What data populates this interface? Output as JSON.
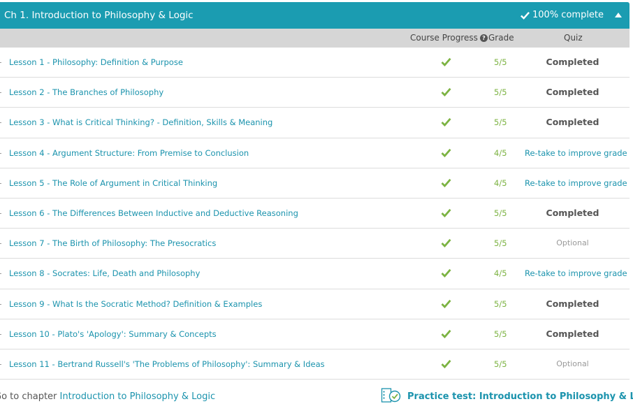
{
  "chapter": {
    "title": "Ch 1. Introduction to Philosophy & Logic",
    "complete_text": "100% complete"
  },
  "columns": {
    "progress": "Course Progress",
    "help": "?",
    "grade": "Grade",
    "quiz": "Quiz"
  },
  "lessons": [
    {
      "title": "Lesson 1 - Philosophy: Definition & Purpose",
      "grade": "5/5",
      "quiz": "Completed",
      "quiz_type": "completed"
    },
    {
      "title": "Lesson 2 - The Branches of Philosophy",
      "grade": "5/5",
      "quiz": "Completed",
      "quiz_type": "completed"
    },
    {
      "title": "Lesson 3 - What is Critical Thinking? - Definition, Skills & Meaning",
      "grade": "5/5",
      "quiz": "Completed",
      "quiz_type": "completed"
    },
    {
      "title": "Lesson 4 - Argument Structure: From Premise to Conclusion",
      "grade": "4/5",
      "quiz": "Re-take to improve grade",
      "quiz_type": "retake"
    },
    {
      "title": "Lesson 5 - The Role of Argument in Critical Thinking",
      "grade": "4/5",
      "quiz": "Re-take to improve grade",
      "quiz_type": "retake"
    },
    {
      "title": "Lesson 6 - The Differences Between Inductive and Deductive Reasoning",
      "grade": "5/5",
      "quiz": "Completed",
      "quiz_type": "completed"
    },
    {
      "title": "Lesson 7 - The Birth of Philosophy: The Presocratics",
      "grade": "5/5",
      "quiz": "Optional",
      "quiz_type": "optional"
    },
    {
      "title": "Lesson 8 - Socrates: Life, Death and Philosophy",
      "grade": "4/5",
      "quiz": "Re-take to improve grade",
      "quiz_type": "retake"
    },
    {
      "title": "Lesson 9 - What Is the Socratic Method? Definition & Examples",
      "grade": "5/5",
      "quiz": "Completed",
      "quiz_type": "completed"
    },
    {
      "title": "Lesson 10 - Plato's 'Apology': Summary & Concepts",
      "grade": "5/5",
      "quiz": "Completed",
      "quiz_type": "completed"
    },
    {
      "title": "Lesson 11 - Bertrand Russell's 'The Problems of Philosophy': Summary & Ideas",
      "grade": "5/5",
      "quiz": "Optional",
      "quiz_type": "optional"
    }
  ],
  "footer": {
    "goto_prefix": "Go to chapter ",
    "goto_link": "Introduction to Philosophy & Logic",
    "practice_link": "Practice test: Introduction to Philosophy & Logic"
  },
  "colors": {
    "header_bg": "#1b9cb1",
    "link": "#1b93ad",
    "check": "#7cb342",
    "column_header_bg": "#d6d6d6"
  },
  "icons": {
    "complete": "checkmark-icon",
    "progress": "checkmark-icon",
    "collapse": "caret-up-icon",
    "practice": "quiz-checklist-icon"
  }
}
